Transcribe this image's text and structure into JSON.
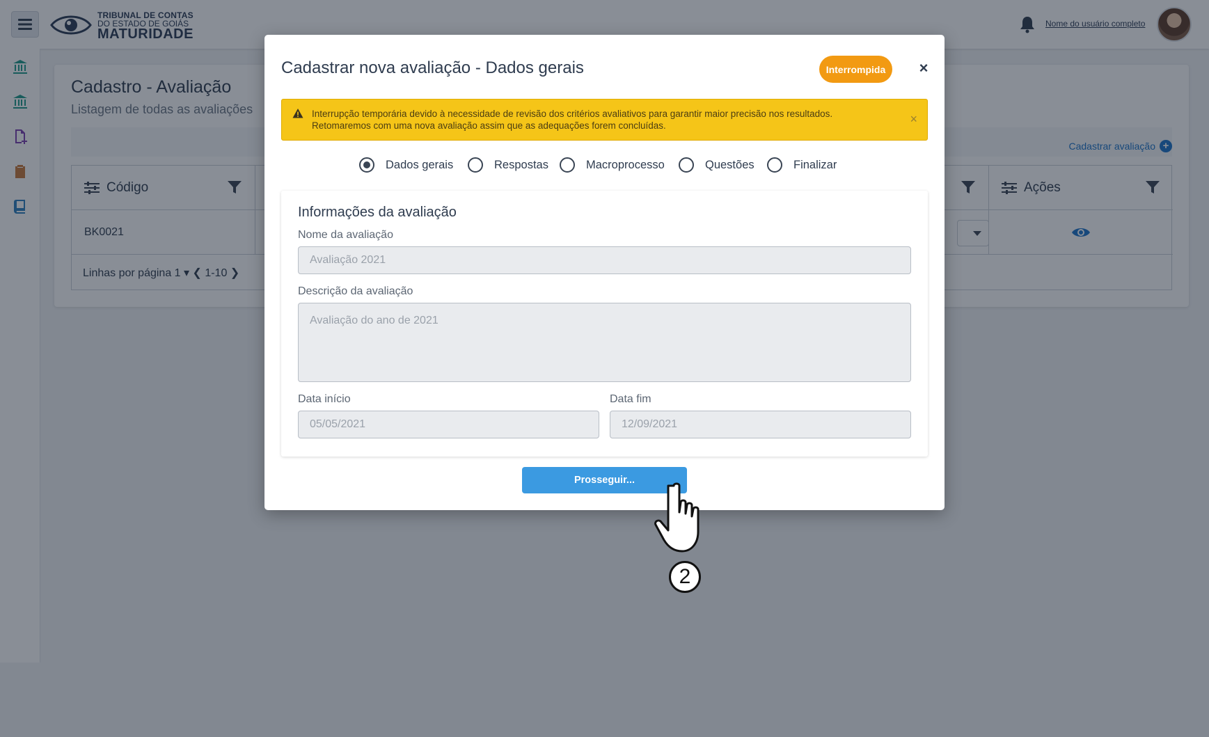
{
  "app": {
    "logo_line1": "TRIBUNAL DE CONTAS",
    "logo_line2": "DO ESTADO DE GOIÁS",
    "logo_line3": "MATURIDADE",
    "user_name": "Nome do usuário completo"
  },
  "page": {
    "title": "Cadastro -  Avaliação",
    "subtitle": "Listagem de todas as avaliações",
    "new_link": "Cadastrar avaliação",
    "table": {
      "col_code": "Código",
      "col_actions": "Ações",
      "row_code": "BK0021"
    },
    "pager": "Linhas por  página  1 ▾ ❮ 1-10 ❯"
  },
  "modal": {
    "title": "Cadastrar nova avaliação -  Dados gerais",
    "status": "Interrompida",
    "close": "×",
    "alert": {
      "line1": "Interrupção temporária devido à necessidade de revisão dos critérios avaliativos para garantir maior precisão nos resultados.",
      "line2": "Retomaremos com uma nova avaliação assim que as adequações forem concluídas.",
      "close": "×"
    },
    "steps": [
      "Dados gerais",
      "Respostas",
      "Macroprocesso",
      "Questões",
      "Finalizar"
    ],
    "active_step": 0,
    "section_title": "Informações da avaliação",
    "fields": {
      "name_label": "Nome da avaliação",
      "name_value": "Avaliação 2021",
      "desc_label": "Descrição da avaliação",
      "desc_value": "Avaliação do ano de 2021",
      "start_label": "Data início",
      "start_value": "05/05/2021",
      "end_label": "Data fim",
      "end_value": "12/09/2021"
    },
    "primary_button": "Prosseguir..."
  },
  "annotation": {
    "step_number": "2"
  },
  "colors": {
    "accent": "#3b9ae1",
    "status_badge": "#f29a12",
    "alert_bg": "#f5c518",
    "link": "#1a73c8"
  }
}
